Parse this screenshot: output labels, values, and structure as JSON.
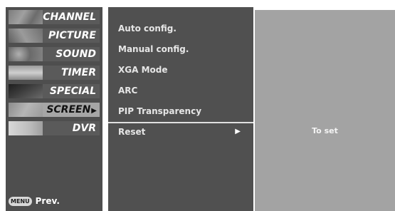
{
  "categories": [
    {
      "label": "CHANNEL",
      "icon": "channel-thumbnail-icon"
    },
    {
      "label": "PICTURE",
      "icon": "picture-thumbnail-icon"
    },
    {
      "label": "SOUND",
      "icon": "sound-thumbnail-icon"
    },
    {
      "label": "TIMER",
      "icon": "timer-thumbnail-icon"
    },
    {
      "label": "SPECIAL",
      "icon": "special-thumbnail-icon"
    },
    {
      "label": "SCREEN",
      "icon": "screen-thumbnail-icon",
      "active": true
    },
    {
      "label": "DVR",
      "icon": "dvr-thumbnail-icon"
    }
  ],
  "active_arrow": "▶",
  "footer": {
    "menu_key": "MENU",
    "prev_label": "Prev."
  },
  "submenu": {
    "items": [
      "Auto config.",
      "Manual config.",
      "XGA Mode",
      "ARC",
      "PIP Transparency",
      "Reset"
    ],
    "selected": "Reset",
    "selected_arrow": "▶"
  },
  "detail": {
    "text": "To set"
  },
  "colors": {
    "panel": "#4e4e4e",
    "submenu_panel": "#505050",
    "detail_panel": "#a3a3a3",
    "active_category": "#a6a6a6"
  }
}
